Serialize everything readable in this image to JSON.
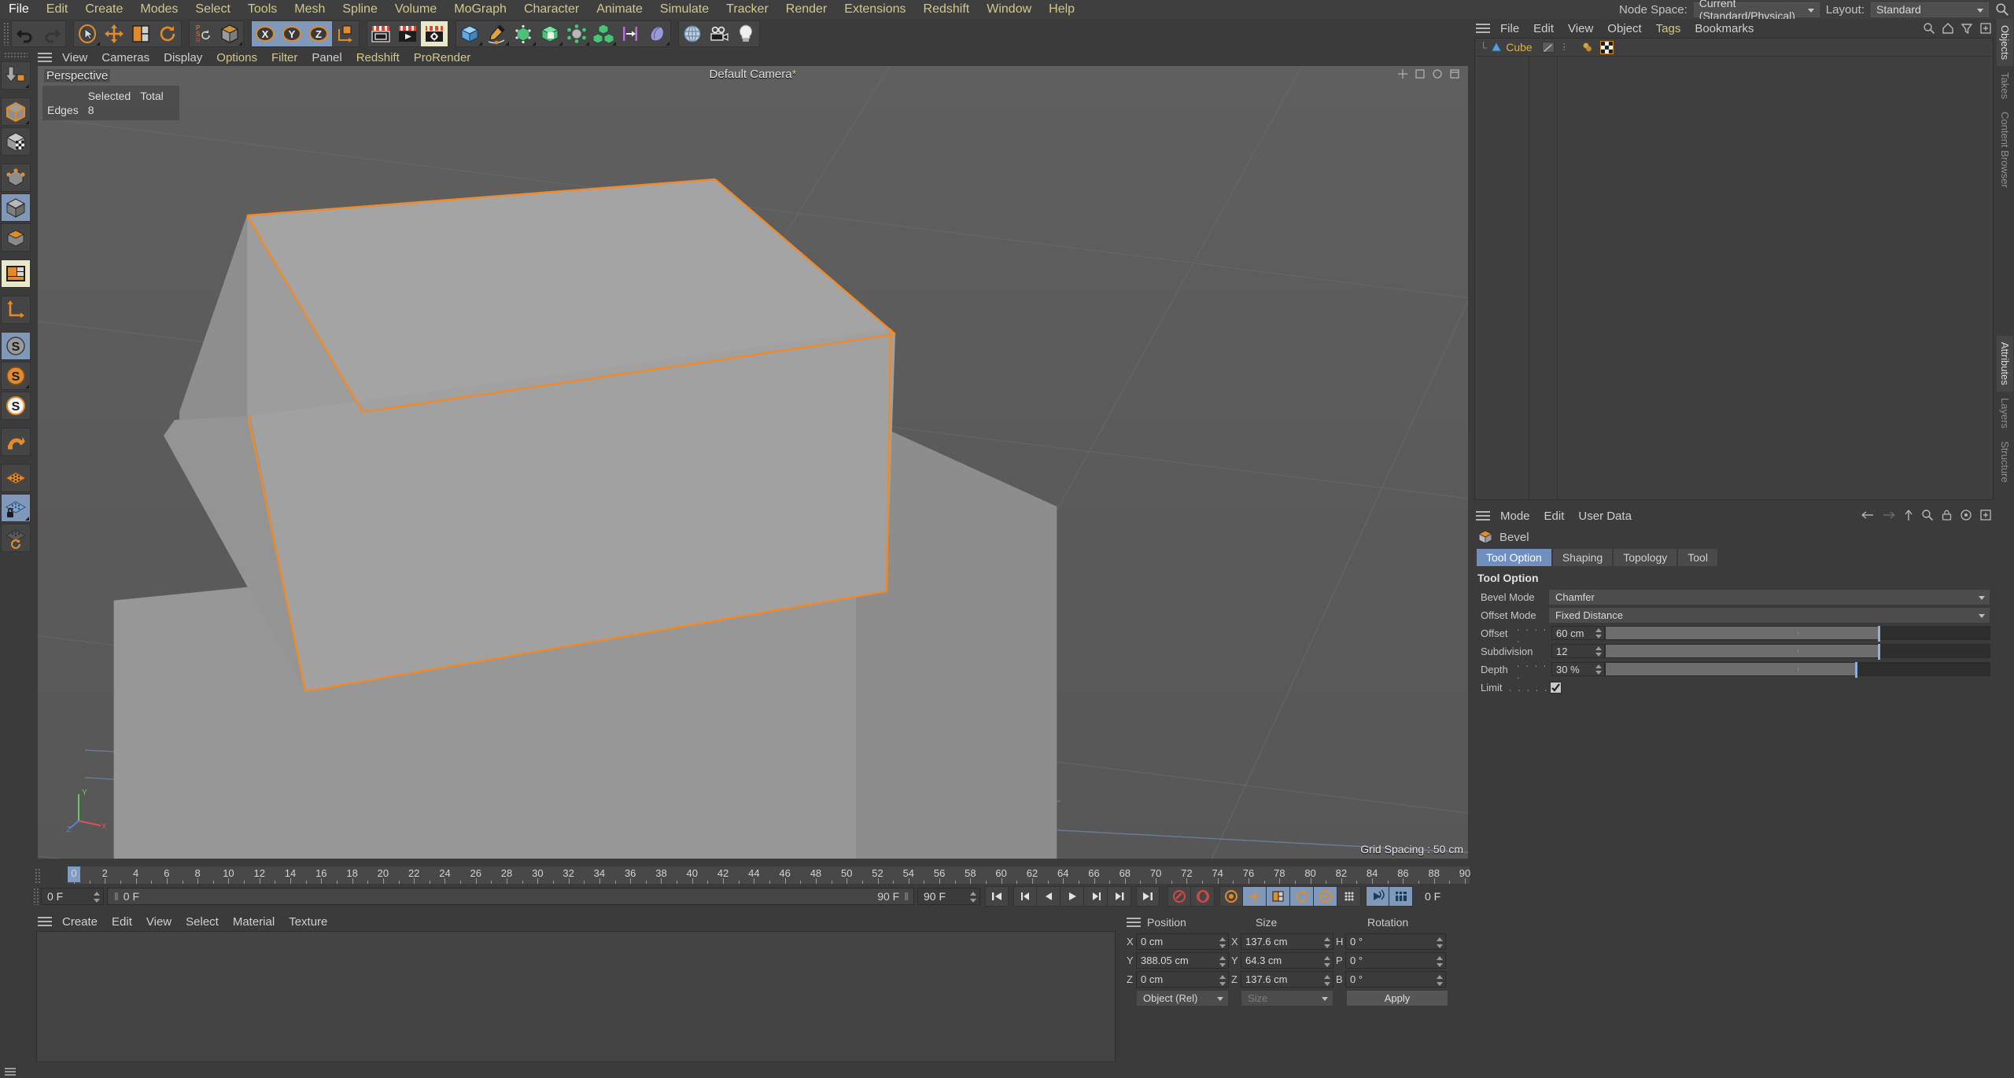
{
  "app": {
    "title": "Cinema 4D"
  },
  "menubar": {
    "items": [
      "File",
      "Edit",
      "Create",
      "Modes",
      "Select",
      "Tools",
      "Mesh",
      "Spline",
      "Volume",
      "MoGraph",
      "Character",
      "Animate",
      "Simulate",
      "Tracker",
      "Render",
      "Extensions",
      "Redshift",
      "Window",
      "Help"
    ]
  },
  "topright": {
    "node_space_label": "Node Space:",
    "node_space_value": "Current (Standard/Physical)",
    "layout_label": "Layout:",
    "layout_value": "Standard",
    "search_icon": "search-icon"
  },
  "main_toolbar": {
    "groups": [
      {
        "name": "undo-redo",
        "buttons": [
          {
            "icon": "undo-icon",
            "label": "Undo",
            "state": "normal"
          },
          {
            "icon": "redo-icon",
            "label": "Redo",
            "state": "disabled"
          }
        ]
      },
      {
        "name": "transform-tools",
        "buttons": [
          {
            "icon": "select-live-icon",
            "label": "Live Selection",
            "state": "normal"
          },
          {
            "icon": "move-icon",
            "label": "Move",
            "state": "normal"
          },
          {
            "icon": "scale-icon",
            "label": "Scale",
            "state": "normal"
          },
          {
            "icon": "rotate-icon",
            "label": "Rotate",
            "state": "normal"
          }
        ]
      },
      {
        "name": "psr-world",
        "buttons": [
          {
            "icon": "psr-icon",
            "label": "PSR",
            "state": "normal"
          },
          {
            "icon": "world-object-axis-icon",
            "label": "World/Object",
            "state": "normal"
          }
        ]
      },
      {
        "name": "axis-locks",
        "buttons": [
          {
            "icon": "x-axis-icon",
            "label": "X",
            "state": "selected"
          },
          {
            "icon": "y-axis-icon",
            "label": "Y",
            "state": "selected"
          },
          {
            "icon": "z-axis-icon",
            "label": "Z",
            "state": "selected"
          },
          {
            "icon": "object-axis-icon",
            "label": "Object Axis",
            "state": "normal"
          }
        ]
      },
      {
        "name": "render-group",
        "buttons": [
          {
            "icon": "render-view-icon",
            "label": "Render View",
            "state": "normal"
          },
          {
            "icon": "render-queue-icon",
            "label": "Render to Picture Viewer",
            "state": "normal"
          },
          {
            "icon": "render-settings-icon",
            "label": "Render Settings",
            "state": "highlight"
          }
        ]
      },
      {
        "name": "primitives-group",
        "buttons": [
          {
            "icon": "cube-primitive-icon",
            "label": "Cube",
            "state": "normal"
          },
          {
            "icon": "spline-pen-icon",
            "label": "Spline",
            "state": "normal"
          },
          {
            "icon": "nurbs-icon",
            "label": "Generators",
            "state": "normal"
          },
          {
            "icon": "boole-icon",
            "label": "Boole",
            "state": "normal"
          },
          {
            "icon": "deformer-icon",
            "label": "Deformers",
            "state": "normal"
          },
          {
            "icon": "mograph-array-icon",
            "label": "MoGraph",
            "state": "normal"
          },
          {
            "icon": "field-icon",
            "label": "Fields",
            "state": "normal"
          },
          {
            "icon": "scene-object-icon",
            "label": "Scene",
            "state": "normal"
          }
        ]
      },
      {
        "name": "camera-light-group",
        "buttons": [
          {
            "icon": "environment-icon",
            "label": "Environment",
            "state": "normal"
          },
          {
            "icon": "camera-icon",
            "label": "Camera",
            "state": "normal"
          },
          {
            "icon": "light-icon",
            "label": "Light",
            "state": "normal"
          }
        ]
      }
    ]
  },
  "left_toolbar": {
    "buttons": [
      {
        "icon": "make-editable-icon",
        "label": "Make Editable",
        "state": "normal"
      },
      {
        "icon": "model-mode-icon",
        "label": "Model Mode",
        "state": "normal"
      },
      {
        "icon": "texture-mode-icon",
        "label": "Texture Mode",
        "state": "normal"
      },
      {
        "icon": "points-mode-icon",
        "label": "Points",
        "state": "normal"
      },
      {
        "icon": "edges-mode-icon",
        "label": "Edges",
        "state": "selected"
      },
      {
        "icon": "polygons-mode-icon",
        "label": "Polygons",
        "state": "normal"
      },
      {
        "icon": "workplane-icon",
        "label": "Workplane",
        "state": "highlight"
      },
      {
        "icon": "axis-modify-icon",
        "label": "Enable Axis",
        "state": "normal"
      },
      {
        "icon": "lock-scale-icon",
        "label": "Lock Scale",
        "state": "selected"
      },
      {
        "icon": "lock-uniform-icon",
        "label": "Uniform Scale",
        "state": "normal"
      },
      {
        "icon": "lock-snap-icon",
        "label": "Snap Scale",
        "state": "normal"
      },
      {
        "icon": "magnet-icon",
        "label": "Magnet",
        "state": "normal"
      },
      {
        "icon": "workplane-grid-icon",
        "label": "Workplane Grid",
        "state": "normal"
      },
      {
        "icon": "lock-workplane-icon",
        "label": "Lock Workplane",
        "state": "selected"
      },
      {
        "icon": "planar-workplane-icon",
        "label": "Planar Workplane",
        "state": "normal"
      }
    ]
  },
  "viewport": {
    "menu": [
      "View",
      "Cameras",
      "Display",
      "Options",
      "Filter",
      "Panel",
      "Redshift",
      "ProRender"
    ],
    "menu_highlight": [
      "Options",
      "Filter",
      "Redshift",
      "ProRender"
    ],
    "perspective_label": "Perspective",
    "camera_label": "Default Camera",
    "grid_spacing": "Grid Spacing : 50 cm",
    "stats": {
      "col_headers": [
        "",
        "Selected",
        "Total"
      ],
      "rows": [
        {
          "label": "Edges",
          "selected": "8",
          "total": ""
        }
      ]
    },
    "axis_gizmo": {
      "x": "X",
      "y": "Y",
      "z": "Z"
    }
  },
  "timeline": {
    "tick_start": 0,
    "tick_end": 90,
    "tick_step": 2,
    "labels": [
      0,
      2,
      4,
      6,
      8,
      10,
      12,
      14,
      16,
      18,
      20,
      22,
      24,
      26,
      28,
      30,
      32,
      34,
      36,
      38,
      40,
      42,
      44,
      46,
      48,
      50,
      52,
      54,
      56,
      58,
      60,
      62,
      64,
      66,
      68,
      70,
      72,
      74,
      76,
      78,
      80,
      82,
      84,
      86,
      88,
      90
    ],
    "current_frame": "0 F",
    "track_start": "0 F",
    "preview_end": "90 F",
    "doc_end": "90 F",
    "right_frame": "0 F",
    "transport": [
      {
        "icon": "go-to-start-icon",
        "label": "Go to Start"
      },
      {
        "icon": "prev-key-icon",
        "label": "Go to Previous Key"
      },
      {
        "icon": "prev-frame-icon",
        "label": "Go to Previous Frame"
      },
      {
        "icon": "play-icon",
        "label": "Play Forwards"
      },
      {
        "icon": "next-frame-icon",
        "label": "Go to Next Frame"
      },
      {
        "icon": "next-key-icon",
        "label": "Go to Next Key"
      },
      {
        "icon": "go-to-end-icon",
        "label": "Go to End"
      }
    ],
    "record_tools": [
      {
        "icon": "record-active-objects-icon",
        "label": "Record Active Objects",
        "state": "normal"
      },
      {
        "icon": "autokeying-icon",
        "label": "Autokeying",
        "state": "normal"
      },
      {
        "icon": "keyframe-selection-icon",
        "label": "Keyframe Selection",
        "state": "normal"
      },
      {
        "icon": "position-key-icon",
        "label": "Position",
        "state": "selected"
      },
      {
        "icon": "scale-key-icon",
        "label": "Scale",
        "state": "selected"
      },
      {
        "icon": "rotation-key-icon",
        "label": "Rotation",
        "state": "selected"
      },
      {
        "icon": "param-key-icon",
        "label": "Parameter",
        "state": "selected"
      },
      {
        "icon": "pla-key-icon",
        "label": "Point Level Animation",
        "state": "normal"
      },
      {
        "icon": "dynamics-key-icon",
        "label": "Dynamics",
        "state": "selected"
      },
      {
        "icon": "timeline-icon",
        "label": "Timeline",
        "state": "selected"
      }
    ]
  },
  "material_manager": {
    "menu": [
      "Create",
      "Edit",
      "View",
      "Select",
      "Material",
      "Texture"
    ]
  },
  "coordinates": {
    "headers": {
      "position": "Position",
      "size": "Size",
      "rotation": "Rotation"
    },
    "rows": [
      {
        "pos_axis": "X",
        "pos_value": "0 cm",
        "size_axis": "X",
        "size_value": "137.6 cm",
        "rot_axis": "H",
        "rot_value": "0 °"
      },
      {
        "pos_axis": "Y",
        "pos_value": "388.05 cm",
        "size_axis": "Y",
        "size_value": "64.3 cm",
        "rot_axis": "P",
        "rot_value": "0 °"
      },
      {
        "pos_axis": "Z",
        "pos_value": "0 cm",
        "size_axis": "Z",
        "size_value": "137.6 cm",
        "rot_axis": "B",
        "rot_value": "0 °"
      }
    ],
    "mode_select": "Object (Rel)",
    "size_select": "Size",
    "apply_label": "Apply"
  },
  "object_manager": {
    "menu": [
      "File",
      "Edit",
      "View",
      "Object",
      "Tags",
      "Bookmarks"
    ],
    "menu_highlight": [
      "Tags"
    ],
    "icons": [
      "search-icon",
      "home-icon",
      "filter-icon",
      "add-icon"
    ],
    "objects": [
      {
        "name": "Cube",
        "icon": "polygon-object-icon",
        "tags": [
          "display-tag-icon",
          "checker-texture-tag-icon"
        ]
      }
    ]
  },
  "attributes": {
    "menu": [
      "Mode",
      "Edit",
      "User Data"
    ],
    "icons": [
      "back-arrow-icon",
      "forward-arrow-icon",
      "up-arrow-icon",
      "search-icon",
      "lock-icon",
      "target-icon",
      "add-icon"
    ],
    "object_title": "Bevel",
    "object_icon": "bevel-tool-icon",
    "tabs": [
      {
        "label": "Tool Option",
        "active": true
      },
      {
        "label": "Shaping",
        "active": false
      },
      {
        "label": "Topology",
        "active": false
      },
      {
        "label": "Tool",
        "active": false
      }
    ],
    "section_title": "Tool Option",
    "fields": [
      {
        "label": "Bevel Mode",
        "dots": "",
        "type": "select",
        "value": "Chamfer"
      },
      {
        "label": "Offset Mode",
        "dots": "",
        "type": "select",
        "value": "Fixed Distance"
      },
      {
        "label": "Offset",
        "dots": ". . . . .",
        "type": "slider",
        "value": "60 cm",
        "fill_pct": 71,
        "knob_pct": 71
      },
      {
        "label": "Subdivision",
        "dots": "",
        "type": "slider",
        "value": "12",
        "fill_pct": 71,
        "knob_pct": 71
      },
      {
        "label": "Depth",
        "dots": ". . . . .",
        "type": "slider",
        "value": "30 %",
        "fill_pct": 65,
        "knob_pct": 65
      },
      {
        "label": "Limit",
        "dots": ". . . . .",
        "type": "checkbox",
        "value": "checked"
      }
    ]
  },
  "vertical_tabs_right": [
    {
      "label": "Objects",
      "active": true
    },
    {
      "label": "Takes",
      "active": false
    },
    {
      "label": "Content Browser",
      "active": false
    }
  ],
  "vertical_tabs_attr": [
    {
      "label": "Attributes",
      "active": true
    },
    {
      "label": "Layers",
      "active": false
    },
    {
      "label": "Structure",
      "active": false
    }
  ],
  "colors": {
    "accent_orange": "#e08b2e",
    "selection_blue": "#8099bb",
    "highlight_yellow": "#e9e8c8",
    "menu_text": "#d2c88c",
    "object_text": "#d9b04a",
    "panel_bg": "#3b3b3b",
    "viewport_bg": "#5a5a5a",
    "edge_highlight": "#f08a28"
  }
}
